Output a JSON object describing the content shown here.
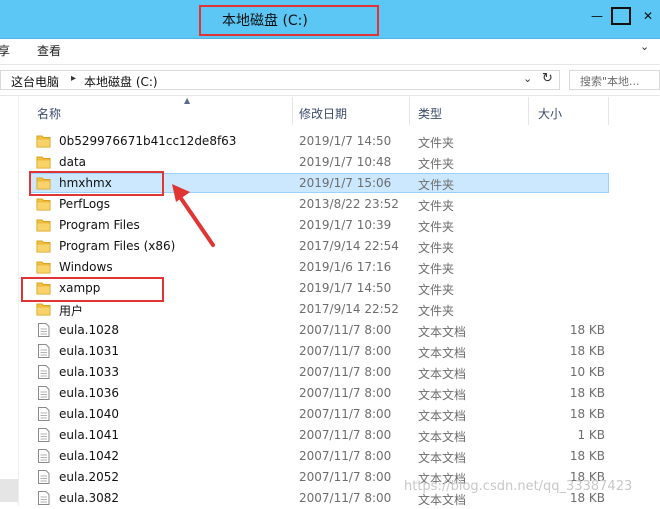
{
  "window": {
    "title": "本地磁盘 (C:)",
    "buttons": {
      "minimize": "—",
      "maximize": "",
      "close": "✕"
    }
  },
  "ribbon": {
    "tabs": [
      "享",
      "查看"
    ],
    "chevron": "⌄"
  },
  "address": {
    "crumbs": [
      "这台电脑",
      "本地磁盘 (C:)"
    ],
    "separator": "▸",
    "search_placeholder": "搜索\"本地..."
  },
  "columns": {
    "name": "名称",
    "date": "修改日期",
    "type": "类型",
    "size": "大小"
  },
  "files": [
    {
      "name": "0b529976671b41cc12de8f63",
      "date": "2019/1/7 14:50",
      "type": "文件夹",
      "size": "",
      "kind": "folder"
    },
    {
      "name": "data",
      "date": "2019/1/7 10:48",
      "type": "文件夹",
      "size": "",
      "kind": "folder"
    },
    {
      "name": "hmxhmx",
      "date": "2019/1/7 15:06",
      "type": "文件夹",
      "size": "",
      "kind": "folder",
      "selected": true
    },
    {
      "name": "PerfLogs",
      "date": "2013/8/22 23:52",
      "type": "文件夹",
      "size": "",
      "kind": "folder"
    },
    {
      "name": "Program Files",
      "date": "2019/1/7 10:39",
      "type": "文件夹",
      "size": "",
      "kind": "folder"
    },
    {
      "name": "Program Files (x86)",
      "date": "2017/9/14 22:54",
      "type": "文件夹",
      "size": "",
      "kind": "folder"
    },
    {
      "name": "Windows",
      "date": "2019/1/6 17:16",
      "type": "文件夹",
      "size": "",
      "kind": "folder"
    },
    {
      "name": "xampp",
      "date": "2019/1/7 14:50",
      "type": "文件夹",
      "size": "",
      "kind": "folder"
    },
    {
      "name": "用户",
      "date": "2017/9/14 22:52",
      "type": "文件夹",
      "size": "",
      "kind": "folder"
    },
    {
      "name": "eula.1028",
      "date": "2007/11/7 8:00",
      "type": "文本文档",
      "size": "18 KB",
      "kind": "file"
    },
    {
      "name": "eula.1031",
      "date": "2007/11/7 8:00",
      "type": "文本文档",
      "size": "18 KB",
      "kind": "file"
    },
    {
      "name": "eula.1033",
      "date": "2007/11/7 8:00",
      "type": "文本文档",
      "size": "10 KB",
      "kind": "file"
    },
    {
      "name": "eula.1036",
      "date": "2007/11/7 8:00",
      "type": "文本文档",
      "size": "18 KB",
      "kind": "file"
    },
    {
      "name": "eula.1040",
      "date": "2007/11/7 8:00",
      "type": "文本文档",
      "size": "18 KB",
      "kind": "file"
    },
    {
      "name": "eula.1041",
      "date": "2007/11/7 8:00",
      "type": "文本文档",
      "size": "1 KB",
      "kind": "file"
    },
    {
      "name": "eula.1042",
      "date": "2007/11/7 8:00",
      "type": "文本文档",
      "size": "18 KB",
      "kind": "file"
    },
    {
      "name": "eula.2052",
      "date": "2007/11/7 8:00",
      "type": "文本文档",
      "size": "18 KB",
      "kind": "file"
    },
    {
      "name": "eula.3082",
      "date": "2007/11/7 8:00",
      "type": "文本文档",
      "size": "18 KB",
      "kind": "file"
    }
  ],
  "watermark": "https://blog.csdn.net/qq_33387423",
  "colors": {
    "titlebar": "#5cc7f4",
    "annotation_red": "#e13434",
    "selection_fill": "#cce8ff",
    "folder_yellow": "#f5c242"
  },
  "icons": {
    "folder": "folder-icon",
    "file": "text-document-icon",
    "dropdown": "chevron-down-icon",
    "refresh": "refresh-icon",
    "sort": "sort-ascending-icon"
  }
}
